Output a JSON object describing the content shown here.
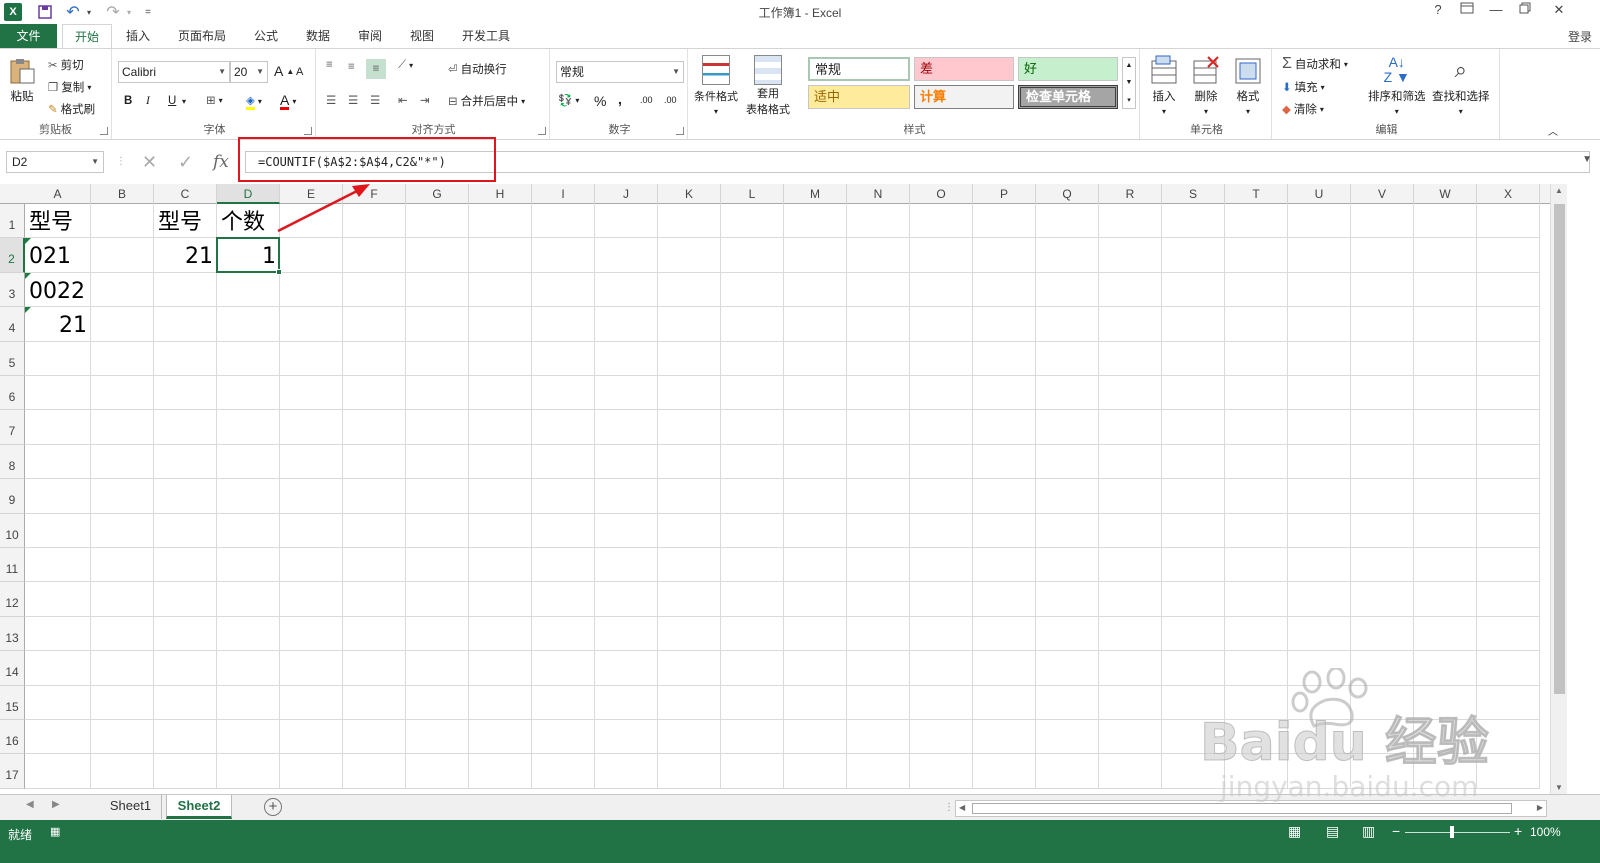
{
  "titlebar": {
    "title": "工作簿1 - Excel",
    "logo": "X",
    "save_icon": "save-icon",
    "undo": "↶",
    "redo": "↷",
    "customize": "=",
    "help": "?",
    "ribbon_display": "ribbon-display-icon",
    "restore": "restore-icon",
    "close": "✕"
  },
  "tabs": [
    "文件",
    "开始",
    "插入",
    "页面布局",
    "公式",
    "数据",
    "审阅",
    "视图",
    "开发工具"
  ],
  "login": "登录",
  "ribbon": {
    "clipboard": {
      "label": "剪贴板",
      "paste": "粘贴",
      "cut": "剪切",
      "copy": "复制",
      "format_painter": "格式刷"
    },
    "font": {
      "label": "字体",
      "name": "Calibri",
      "size": "20",
      "bold": "B",
      "italic": "I",
      "underline": "U",
      "grow": "A",
      "shrink": "A",
      "font_color": "A",
      "phonetic": "wén"
    },
    "alignment": {
      "label": "对齐方式",
      "wrap": "自动换行",
      "merge": "合并后居中"
    },
    "number": {
      "label": "数字",
      "format": "常规",
      "percent": "%",
      "comma": ",",
      "inc": ".00",
      "dec": ".00"
    },
    "styles": {
      "label": "样式",
      "conditional": "条件格式",
      "table_line1": "套用",
      "table_line2": "表格格式",
      "cells": [
        "常规",
        "差",
        "好",
        "适中",
        "计算",
        "检查单元格"
      ]
    },
    "cells": {
      "label": "单元格",
      "insert": "插入",
      "delete": "删除",
      "format": "格式"
    },
    "editing": {
      "label": "编辑",
      "autosum": "自动求和",
      "fill": "填充",
      "clear": "清除",
      "sort": "排序和筛选",
      "find": "查找和选择"
    }
  },
  "formula_bar": {
    "name_box": "D2",
    "fx": "fx",
    "formula": "=COUNTIF($A$2:$A$4,C2&\"*\")"
  },
  "grid": {
    "columns": [
      "A",
      "B",
      "C",
      "D",
      "E",
      "F",
      "G",
      "H",
      "I",
      "J",
      "K",
      "L",
      "M",
      "N",
      "O",
      "P",
      "Q",
      "R",
      "S",
      "T",
      "U",
      "V",
      "W",
      "X"
    ],
    "rows": [
      "1",
      "2",
      "3",
      "4",
      "5",
      "6",
      "7",
      "8",
      "9",
      "10",
      "11",
      "12",
      "13",
      "14",
      "15",
      "16",
      "17"
    ],
    "cells": {
      "A1": "型号",
      "C1": "型号",
      "D1": "个数",
      "A2": "021",
      "C2": "21",
      "D2": "1",
      "A3": "0022",
      "A4": "21"
    },
    "selected_cell": "D2"
  },
  "sheets": {
    "tabs": [
      "Sheet1",
      "Sheet2"
    ],
    "active": "Sheet2",
    "add": "+"
  },
  "status": {
    "text": "就绪",
    "zoom": "100%"
  },
  "watermark": {
    "brand": "Baidu 经验",
    "url": "jingyan.baidu.com"
  },
  "colors": {
    "accent": "#217346",
    "annotation_red": "#e0161d"
  }
}
